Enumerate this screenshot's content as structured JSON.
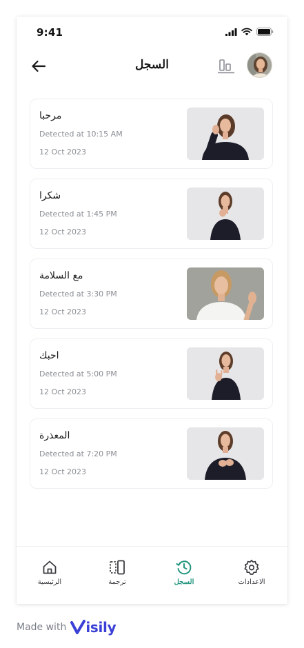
{
  "status_bar": {
    "time": "9:41"
  },
  "header": {
    "title": "السجل"
  },
  "history": [
    {
      "word": "مرحبا",
      "detected": "Detected at 10:15 AM",
      "date": "12 Oct 2023",
      "thumb": "woman-waving-hello"
    },
    {
      "word": "شكرا",
      "detected": "Detected at 1:45 PM",
      "date": "12 Oct 2023",
      "thumb": "woman-thank-you-sign"
    },
    {
      "word": "مع السلامة",
      "detected": "Detected at 3:30 PM",
      "date": "12 Oct 2023",
      "thumb": "woman-smiling-waving-goodbye"
    },
    {
      "word": "احبك",
      "detected": "Detected at 5:00 PM",
      "date": "12 Oct 2023",
      "thumb": "woman-i-love-you-sign"
    },
    {
      "word": "المعذرة",
      "detected": "Detected at 7:20 PM",
      "date": "12 Oct 2023",
      "thumb": "woman-sorry-sign"
    }
  ],
  "bottom_nav": {
    "items": [
      {
        "label": "الرئيسية",
        "icon": "home-icon",
        "active": false
      },
      {
        "label": "ترجمة",
        "icon": "translate-icon",
        "active": false
      },
      {
        "label": "السجل",
        "icon": "history-icon",
        "active": true
      },
      {
        "label": "الاعدادات",
        "icon": "settings-icon",
        "active": false
      }
    ]
  },
  "footer": {
    "made_with": "Made with",
    "brand": "isily"
  },
  "colors": {
    "accent": "#23957f",
    "brand": "#3a3fd6",
    "muted_text": "#8a8d94"
  }
}
